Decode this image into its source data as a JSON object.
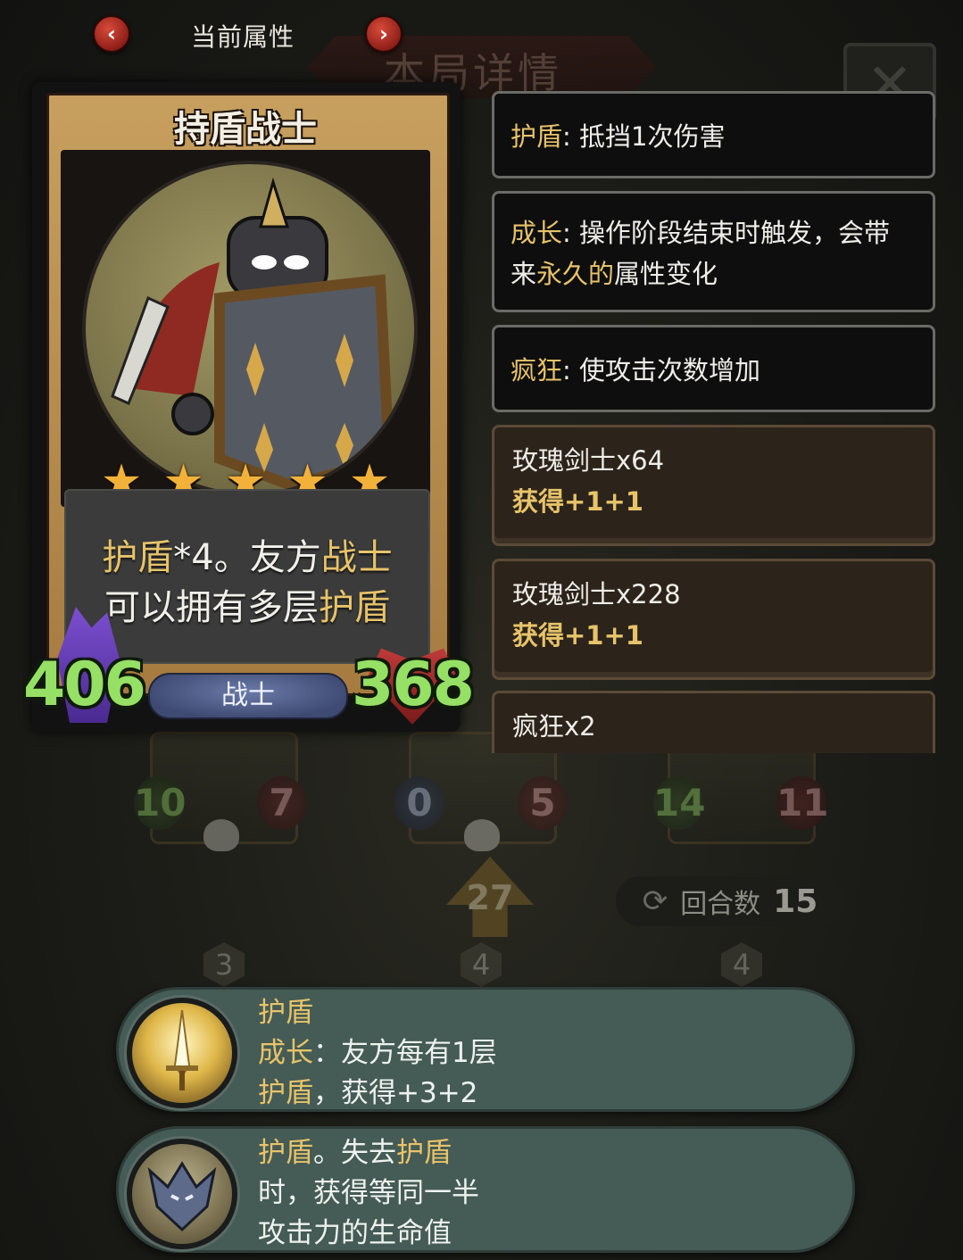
{
  "header": {
    "prev_icon": "chevron-left",
    "next_icon": "chevron-right",
    "prev_glyph": "‹",
    "next_glyph": "›",
    "title": "当前属性",
    "background_title": "本局详情",
    "background_close_glyph": "✕"
  },
  "card": {
    "name": "持盾战士",
    "stars": 5,
    "star_glyph": "★",
    "description": {
      "line1": [
        {
          "text": "护盾",
          "highlight": true
        },
        {
          "text": "*4。友方",
          "highlight": false
        },
        {
          "text": "战士",
          "highlight": true
        }
      ],
      "line2": [
        {
          "text": "可以拥有多层",
          "highlight": false
        },
        {
          "text": "护盾",
          "highlight": true
        }
      ]
    },
    "attack": "406",
    "health": "368",
    "class_label": "战士"
  },
  "keywords": [
    {
      "keyword": "护盾",
      "sep": ": ",
      "line1": "抵挡1次伤害",
      "line2": ""
    },
    {
      "keyword": "成长",
      "sep": ": ",
      "line1": "操作阶段结束时触发，会带",
      "line2_pre": "来",
      "line2_hl": "永久的",
      "line2_post": "属性变化"
    },
    {
      "keyword": "疯狂",
      "sep": ": ",
      "line1": "使攻击次数增加",
      "line2": ""
    }
  ],
  "sources": [
    {
      "title": "玫瑰剑士x64",
      "gain": "获得+1+1"
    },
    {
      "title": "玫瑰剑士x228",
      "gain": "获得+1+1"
    },
    {
      "title": "疯狂x2",
      "gain": ""
    }
  ],
  "board": {
    "slots": [
      {
        "attack": "10",
        "health": "7"
      },
      {
        "attack": "0",
        "health": "5"
      },
      {
        "attack": "14",
        "health": "11"
      }
    ],
    "center_counter": "27",
    "round_label": "回合数",
    "round_value": "15",
    "tiers": [
      "3",
      "4",
      "4"
    ]
  },
  "tooltips": [
    {
      "icon": "golden-sword-icon",
      "lines": [
        [
          {
            "text": "护盾",
            "highlight": true
          }
        ],
        [
          {
            "text": "成长",
            "highlight": true
          },
          {
            "text": "：友方每有1层",
            "highlight": false
          }
        ],
        [
          {
            "text": "护盾",
            "highlight": true
          },
          {
            "text": "，获得+3+2",
            "highlight": false
          }
        ]
      ]
    },
    {
      "icon": "dragon-helm-icon",
      "lines": [
        [
          {
            "text": "护盾",
            "highlight": true
          },
          {
            "text": "。失去",
            "highlight": false
          },
          {
            "text": "护盾",
            "highlight": true
          }
        ],
        [
          {
            "text": "时，获得等同一半",
            "highlight": false
          }
        ],
        [
          {
            "text": "攻击力的生命值",
            "highlight": false
          }
        ]
      ]
    }
  ],
  "colors": {
    "highlight": "#e7c36a",
    "attack_green": "#95e065",
    "card_gold": "#c79f5e",
    "bubble_teal": "#455b55"
  }
}
